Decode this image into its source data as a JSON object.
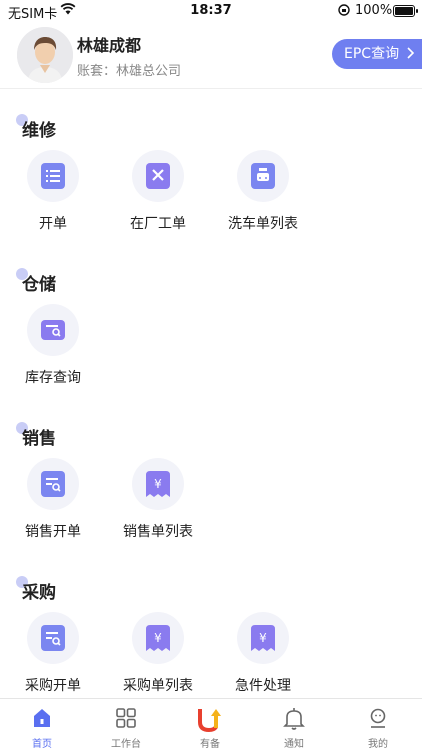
{
  "status_bar": {
    "carrier": "无SIM卡",
    "time": "18:37",
    "battery": "100%"
  },
  "profile": {
    "name": "林雄成都",
    "account": "账套：林雄总公司",
    "epc_label": "EPC查询"
  },
  "sections": [
    {
      "title": "维修",
      "items": [
        "开单",
        "在厂工单",
        "洗车单列表"
      ]
    },
    {
      "title": "仓储",
      "items": [
        "库存查询"
      ]
    },
    {
      "title": "销售",
      "items": [
        "销售开单",
        "销售单列表"
      ]
    },
    {
      "title": "采购",
      "items": [
        "采购开单",
        "采购单列表",
        "急件处理"
      ]
    }
  ],
  "tabs": [
    "首页",
    "工作台",
    "有备",
    "通知",
    "我的"
  ],
  "colors": {
    "accent": "#6f7ff0",
    "icon_purple": "#8a7bef",
    "icon_bg": "#f2f3f9",
    "active_tab": "#5a6ff0",
    "logo_red": "#e8402f",
    "logo_yellow": "#f5b21b"
  }
}
